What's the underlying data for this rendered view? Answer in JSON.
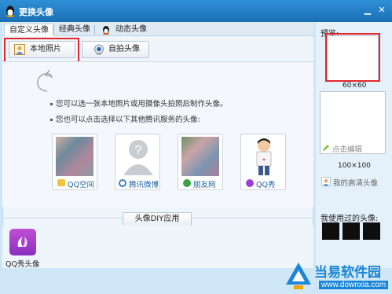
{
  "window": {
    "title": "更换头像"
  },
  "tabs": [
    {
      "label": "自定义头像",
      "active": true
    },
    {
      "label": "经典头像",
      "active": false
    },
    {
      "label": "动态头像",
      "active": false
    }
  ],
  "toolbar": {
    "local_photo": "本地照片",
    "selfie": "自拍头像"
  },
  "hints": [
    "您可以选一张本地照片或用摄像头拍照后制作头像。",
    "您也可以点击选择以下其他腾讯服务的头像:"
  ],
  "services": [
    {
      "label": "QQ空间"
    },
    {
      "label": "腾讯微博"
    },
    {
      "label": "朋友网"
    },
    {
      "label": "QQ秀"
    }
  ],
  "diy_button": "头像DIY应用",
  "qq_show_avatar": "QQ秀头像",
  "right": {
    "preview_label": "预览:",
    "size_small": "60×60",
    "edit_link": "点击编辑",
    "size_large": "100×100",
    "hd_link": "我的高清头像",
    "used_label": "我使用过的头像:"
  },
  "watermark": {
    "title": "当易软件园",
    "url": "www.downxia.com"
  },
  "colors": {
    "titlebar": "#1a6fb5",
    "highlight": "#e3262b"
  }
}
